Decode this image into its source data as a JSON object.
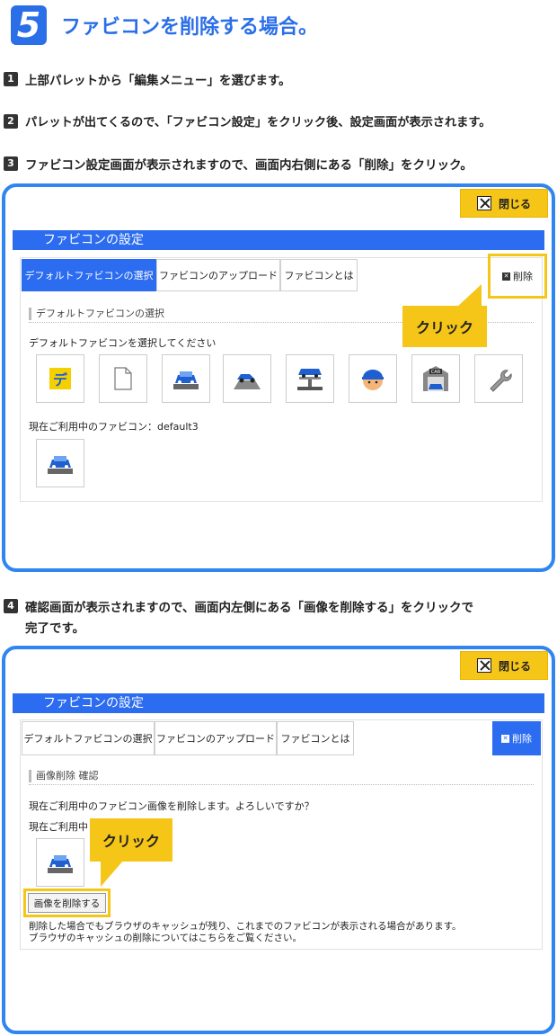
{
  "header": {
    "step_number": "5",
    "title": "ファビコンを削除する場合。"
  },
  "steps": [
    {
      "num": "1",
      "text": "上部パレットから「編集メニュー」を選びます。"
    },
    {
      "num": "2",
      "text": "パレットが出てくるので、「ファビコン設定」をクリック後、設定画面が表示されます。"
    },
    {
      "num": "3",
      "text": "ファビコン設定画面が表示されますので、画面内右側にある「削除」をクリック。"
    },
    {
      "num": "4",
      "text_line1": "確認画面が表示されますので、画面内左側にある「画像を削除する」をクリックで",
      "text_line2": "完了です。"
    }
  ],
  "panel1": {
    "close_label": "閉じる",
    "title": "ファビコンの設定",
    "tabs": [
      {
        "label": "デフォルトファビコンの選択",
        "active": true
      },
      {
        "label": "ファビコンのアップロード",
        "active": false
      },
      {
        "label": "ファビコンとは",
        "active": false
      }
    ],
    "delete_label": "削除",
    "section_title": "デフォルトファビコンの選択",
    "instruction": "デフォルトファビコンを選択してください",
    "icons": [
      "yellow-de-icon",
      "blank-document-icon",
      "car-front-icon",
      "car-side-icon",
      "car-lift-icon",
      "mechanic-face-icon",
      "garage-car-icon",
      "wrench-icon"
    ],
    "current_label": "現在ご利用中のファビコン：default3",
    "callout": "クリック"
  },
  "panel2": {
    "close_label": "閉じる",
    "title": "ファビコンの設定",
    "tabs": [
      {
        "label": "デフォルトファビコンの選択",
        "active": false
      },
      {
        "label": "ファビコンのアップロード",
        "active": false
      },
      {
        "label": "ファビコンとは",
        "active": false
      }
    ],
    "delete_label": "削除",
    "section_title": "画像削除 確認",
    "confirm_text": "現在ご利用中のファビコン画像を削除します。よろしいですか？",
    "current_label_partial": "現在ご利用中",
    "delete_image_button": "画像を削除する",
    "note_line1": "削除した場合でもブラウザのキャッシュが残り、これまでのファビコンが表示される場合があります。",
    "note_line2": "ブラウザのキャッシュの削除についてはこちらをご覧ください。",
    "callout": "クリック"
  },
  "colors": {
    "accent_blue": "#2c6cf0",
    "panel_border": "#2f86f0",
    "highlight_yellow": "#f5c518"
  }
}
